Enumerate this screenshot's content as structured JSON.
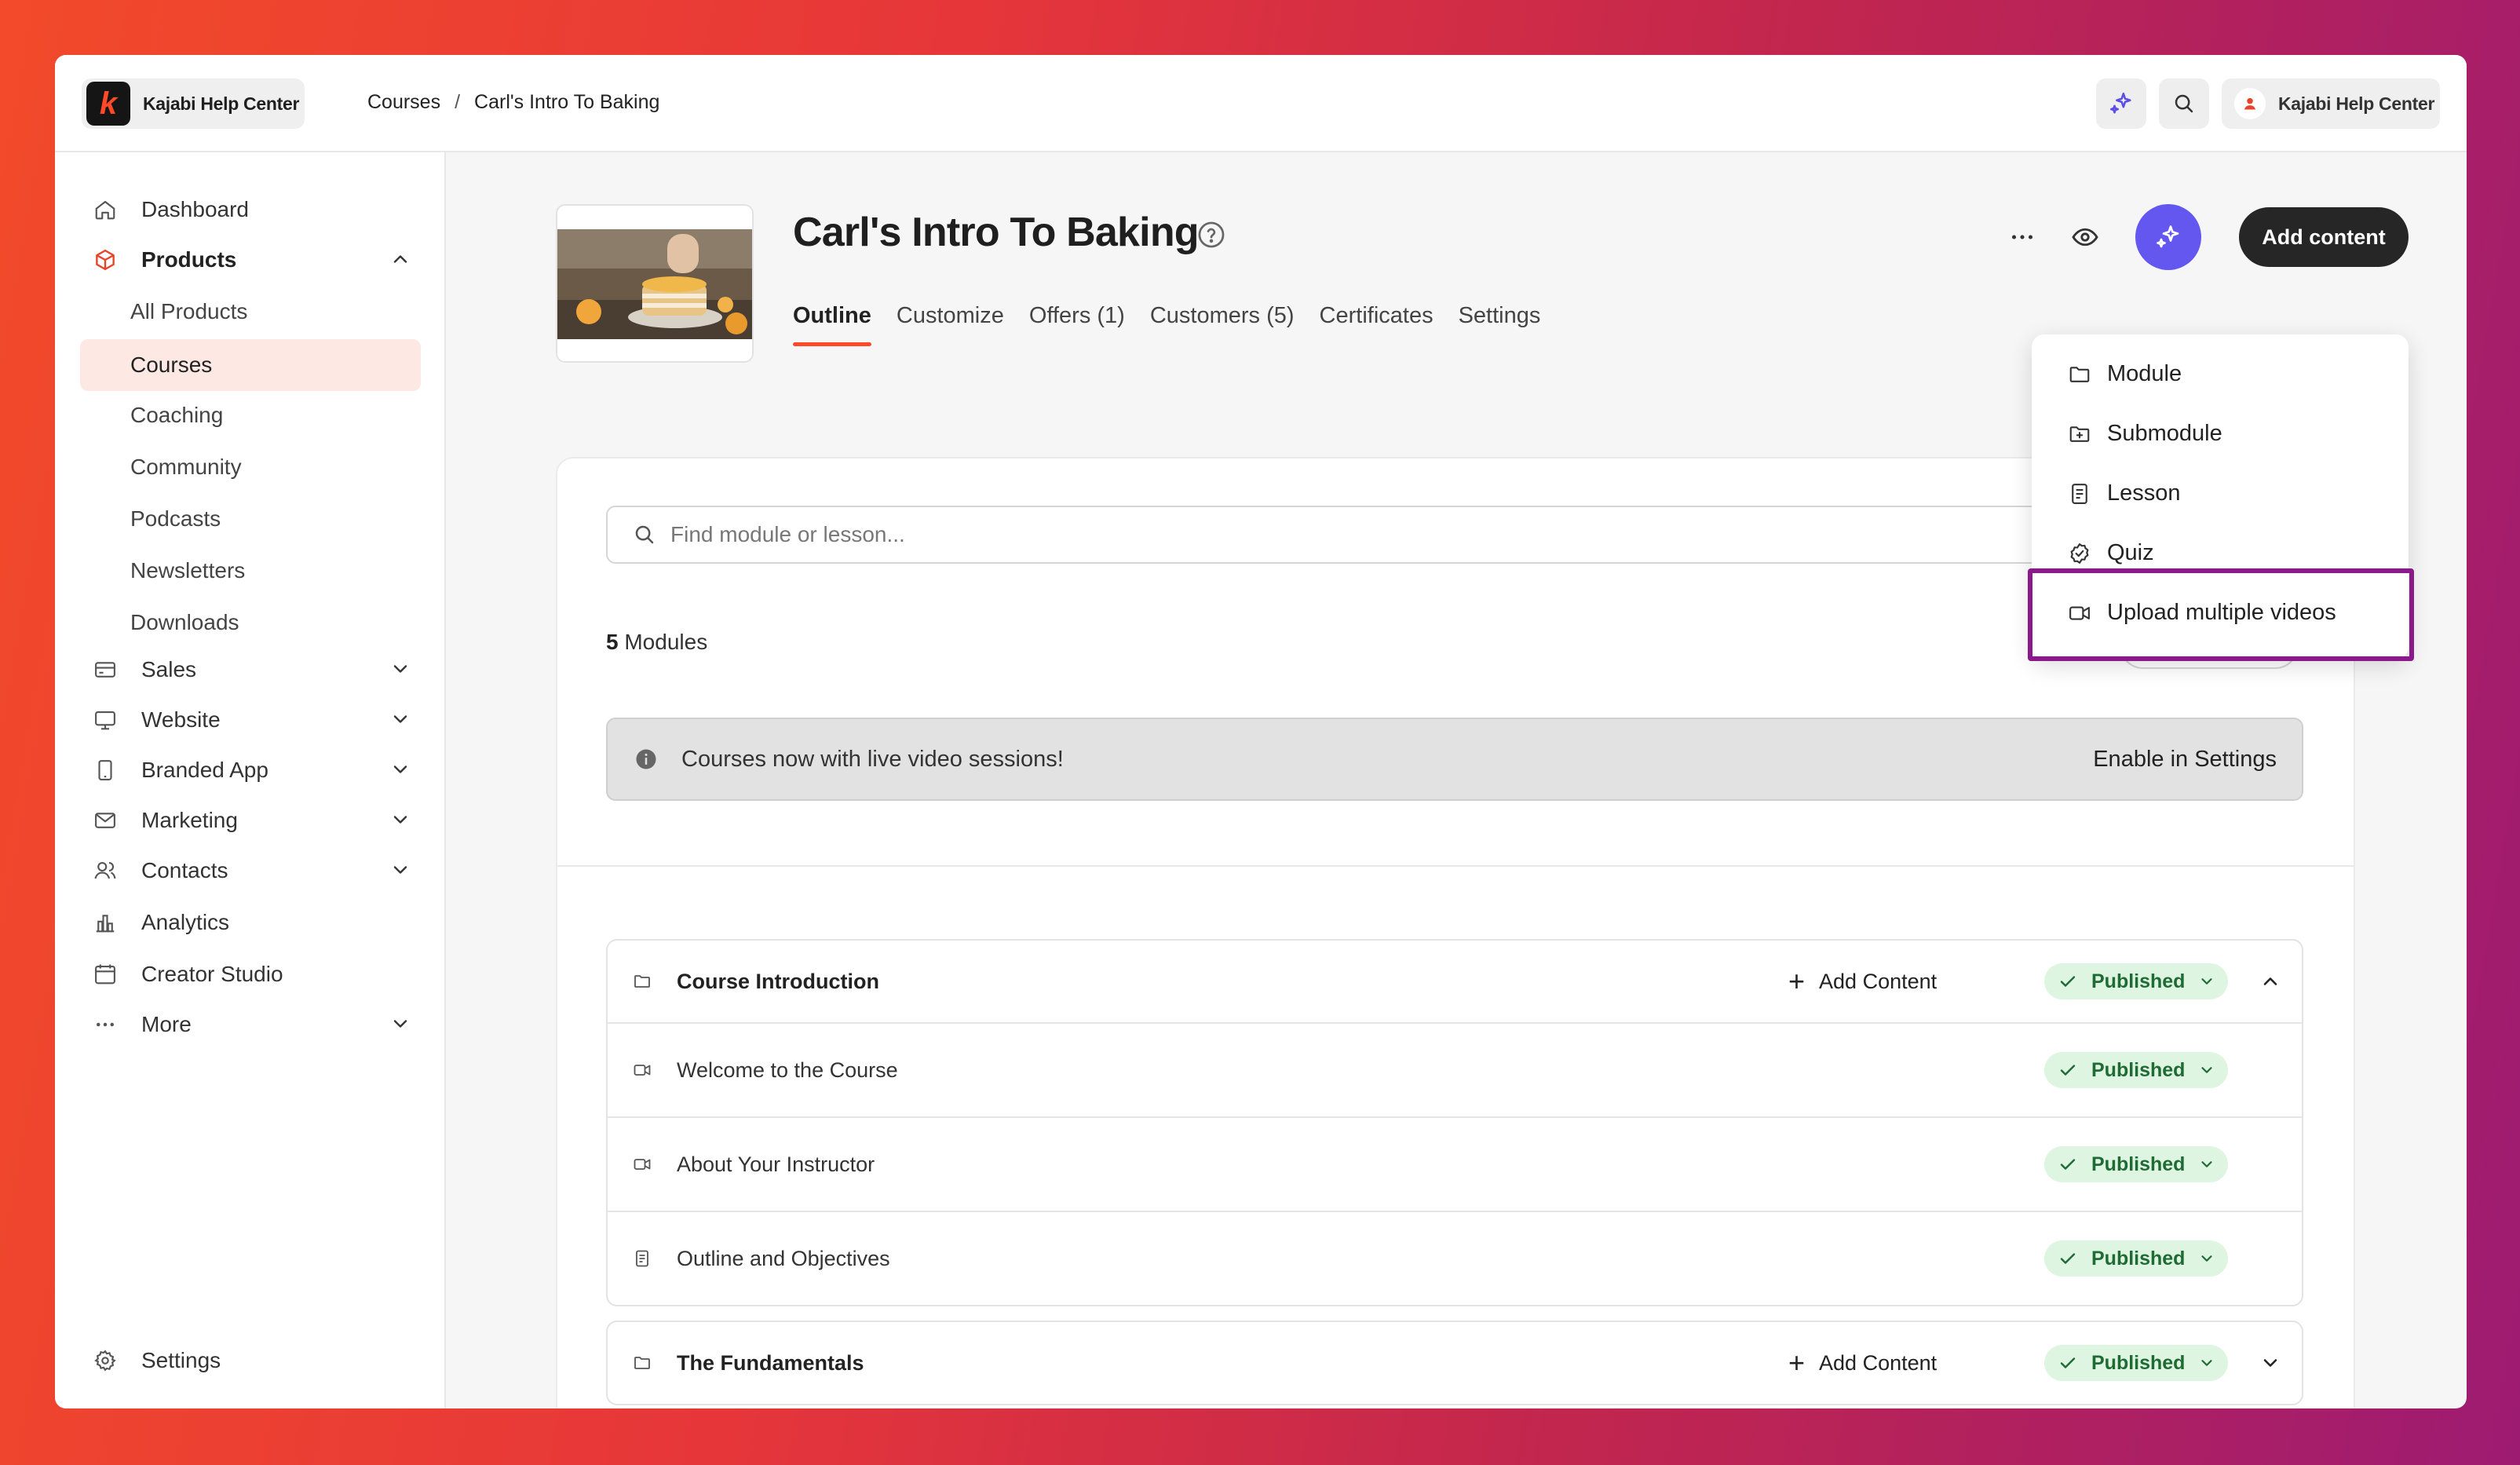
{
  "brand": {
    "name": "Kajabi Help Center",
    "logo_letter": "k"
  },
  "breadcrumb": {
    "parent": "Courses",
    "separator": "/",
    "current": "Carl's Intro To Baking"
  },
  "account": {
    "name": "Kajabi Help Center"
  },
  "sidebar": {
    "items": [
      {
        "label": "Dashboard"
      },
      {
        "label": "Products"
      },
      {
        "label": "All Products"
      },
      {
        "label": "Courses"
      },
      {
        "label": "Coaching"
      },
      {
        "label": "Community"
      },
      {
        "label": "Podcasts"
      },
      {
        "label": "Newsletters"
      },
      {
        "label": "Downloads"
      },
      {
        "label": "Sales"
      },
      {
        "label": "Website"
      },
      {
        "label": "Branded App"
      },
      {
        "label": "Marketing"
      },
      {
        "label": "Contacts"
      },
      {
        "label": "Analytics"
      },
      {
        "label": "Creator Studio"
      },
      {
        "label": "More"
      }
    ],
    "footer": {
      "label": "Settings"
    }
  },
  "course": {
    "title": "Carl's Intro To Baking",
    "tabs": [
      {
        "label": "Outline"
      },
      {
        "label": "Customize"
      },
      {
        "label": "Offers (1)"
      },
      {
        "label": "Customers (5)"
      },
      {
        "label": "Certificates"
      },
      {
        "label": "Settings"
      }
    ],
    "add_content_label": "Add content"
  },
  "search": {
    "placeholder": "Find module or lesson..."
  },
  "modules_count": {
    "number": "5",
    "label": "Modules"
  },
  "banner": {
    "message": "Courses now with live video sessions!",
    "link": "Enable in Settings"
  },
  "dropdown": {
    "items": [
      {
        "label": "Module",
        "icon": "folder-icon"
      },
      {
        "label": "Submodule",
        "icon": "folder-plus-icon"
      },
      {
        "label": "Lesson",
        "icon": "document-icon"
      },
      {
        "label": "Quiz",
        "icon": "badge-check-icon"
      },
      {
        "label": "Upload multiple videos",
        "icon": "video-icon"
      }
    ]
  },
  "outline": {
    "add_content_label": "Add Content",
    "status_label": "Published",
    "modules": [
      {
        "title": "Course Introduction",
        "lessons": [
          {
            "title": "Welcome to the Course",
            "icon": "video-icon"
          },
          {
            "title": "About Your Instructor",
            "icon": "video-icon"
          },
          {
            "title": "Outline and Objectives",
            "icon": "document-icon"
          }
        ]
      },
      {
        "title": "The Fundamentals",
        "lessons": []
      }
    ]
  },
  "colors": {
    "accent": "#ff4a2a",
    "ai_button": "#6457f0",
    "published_bg": "#def5e2",
    "highlight": "#8a1a8a"
  }
}
